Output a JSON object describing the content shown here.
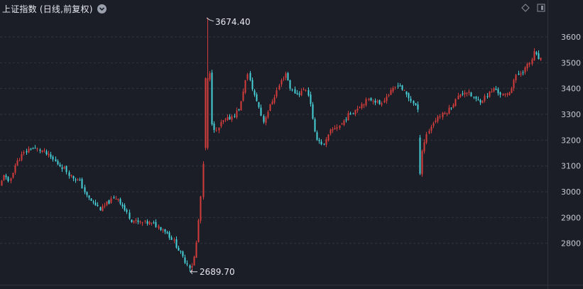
{
  "header": {
    "title": "上证指数 (日线,前复权)"
  },
  "icons": {
    "dropdown": "chevron-down-icon",
    "diamond": "diamond-icon",
    "panel": "panel-toggle-icon"
  },
  "colors": {
    "background": "#1b1e26",
    "up": "#d43c3c",
    "down": "#46d0d8",
    "grid": "#30343e",
    "axis_text": "#c7cad2"
  },
  "chart_data": {
    "type": "candlestick",
    "ytick_labels": [
      "3600",
      "3500",
      "3400",
      "3300",
      "3200",
      "3100",
      "3000",
      "2900",
      "2800"
    ],
    "ylim": [
      2680,
      3700
    ],
    "grid": "horizontal dashed",
    "annotations": [
      {
        "label": "3674.40",
        "value": 3674.4,
        "type": "high"
      },
      {
        "label": "2689.70",
        "value": 2689.7,
        "type": "low"
      }
    ],
    "close_path": [
      [
        0,
        3020
      ],
      [
        5,
        3070
      ],
      [
        12,
        3030
      ],
      [
        20,
        3100
      ],
      [
        30,
        3140
      ],
      [
        42,
        3170
      ],
      [
        58,
        3160
      ],
      [
        68,
        3140
      ],
      [
        80,
        3110
      ],
      [
        90,
        3090
      ],
      [
        100,
        3060
      ],
      [
        112,
        3040
      ],
      [
        122,
        2980
      ],
      [
        130,
        2960
      ],
      [
        142,
        2930
      ],
      [
        152,
        2960
      ],
      [
        165,
        2980
      ],
      [
        175,
        2930
      ],
      [
        185,
        2890
      ],
      [
        195,
        2880
      ],
      [
        208,
        2880
      ],
      [
        220,
        2870
      ],
      [
        232,
        2850
      ],
      [
        244,
        2810
      ],
      [
        252,
        2770
      ],
      [
        258,
        2740
      ],
      [
        264,
        2720
      ],
      [
        268,
        2705
      ],
      [
        272,
        2730
      ],
      [
        276,
        2800
      ],
      [
        280,
        2910
      ],
      [
        283,
        3000
      ],
      [
        286,
        3120
      ],
      [
        289,
        3480
      ],
      [
        292,
        3640
      ],
      [
        295,
        3450
      ],
      [
        298,
        3270
      ],
      [
        304,
        3230
      ],
      [
        312,
        3270
      ],
      [
        320,
        3280
      ],
      [
        330,
        3300
      ],
      [
        338,
        3330
      ],
      [
        344,
        3420
      ],
      [
        350,
        3460
      ],
      [
        356,
        3380
      ],
      [
        362,
        3350
      ],
      [
        370,
        3270
      ],
      [
        378,
        3320
      ],
      [
        386,
        3370
      ],
      [
        394,
        3420
      ],
      [
        402,
        3460
      ],
      [
        410,
        3390
      ],
      [
        420,
        3380
      ],
      [
        430,
        3400
      ],
      [
        436,
        3360
      ],
      [
        442,
        3230
      ],
      [
        448,
        3200
      ],
      [
        456,
        3180
      ],
      [
        464,
        3230
      ],
      [
        472,
        3250
      ],
      [
        480,
        3260
      ],
      [
        488,
        3290
      ],
      [
        496,
        3310
      ],
      [
        504,
        3330
      ],
      [
        514,
        3350
      ],
      [
        524,
        3360
      ],
      [
        534,
        3340
      ],
      [
        544,
        3370
      ],
      [
        552,
        3390
      ],
      [
        560,
        3420
      ],
      [
        568,
        3390
      ],
      [
        576,
        3360
      ],
      [
        584,
        3340
      ],
      [
        588,
        3310
      ],
      [
        591,
        3110
      ],
      [
        594,
        3160
      ],
      [
        600,
        3220
      ],
      [
        608,
        3260
      ],
      [
        616,
        3290
      ],
      [
        624,
        3300
      ],
      [
        632,
        3320
      ],
      [
        640,
        3350
      ],
      [
        648,
        3380
      ],
      [
        656,
        3390
      ],
      [
        664,
        3370
      ],
      [
        672,
        3350
      ],
      [
        680,
        3360
      ],
      [
        688,
        3380
      ],
      [
        696,
        3400
      ],
      [
        704,
        3380
      ],
      [
        712,
        3370
      ],
      [
        718,
        3390
      ],
      [
        724,
        3440
      ],
      [
        732,
        3460
      ],
      [
        740,
        3480
      ],
      [
        748,
        3510
      ],
      [
        752,
        3540
      ],
      [
        756,
        3520
      ],
      [
        762,
        3510
      ]
    ]
  }
}
